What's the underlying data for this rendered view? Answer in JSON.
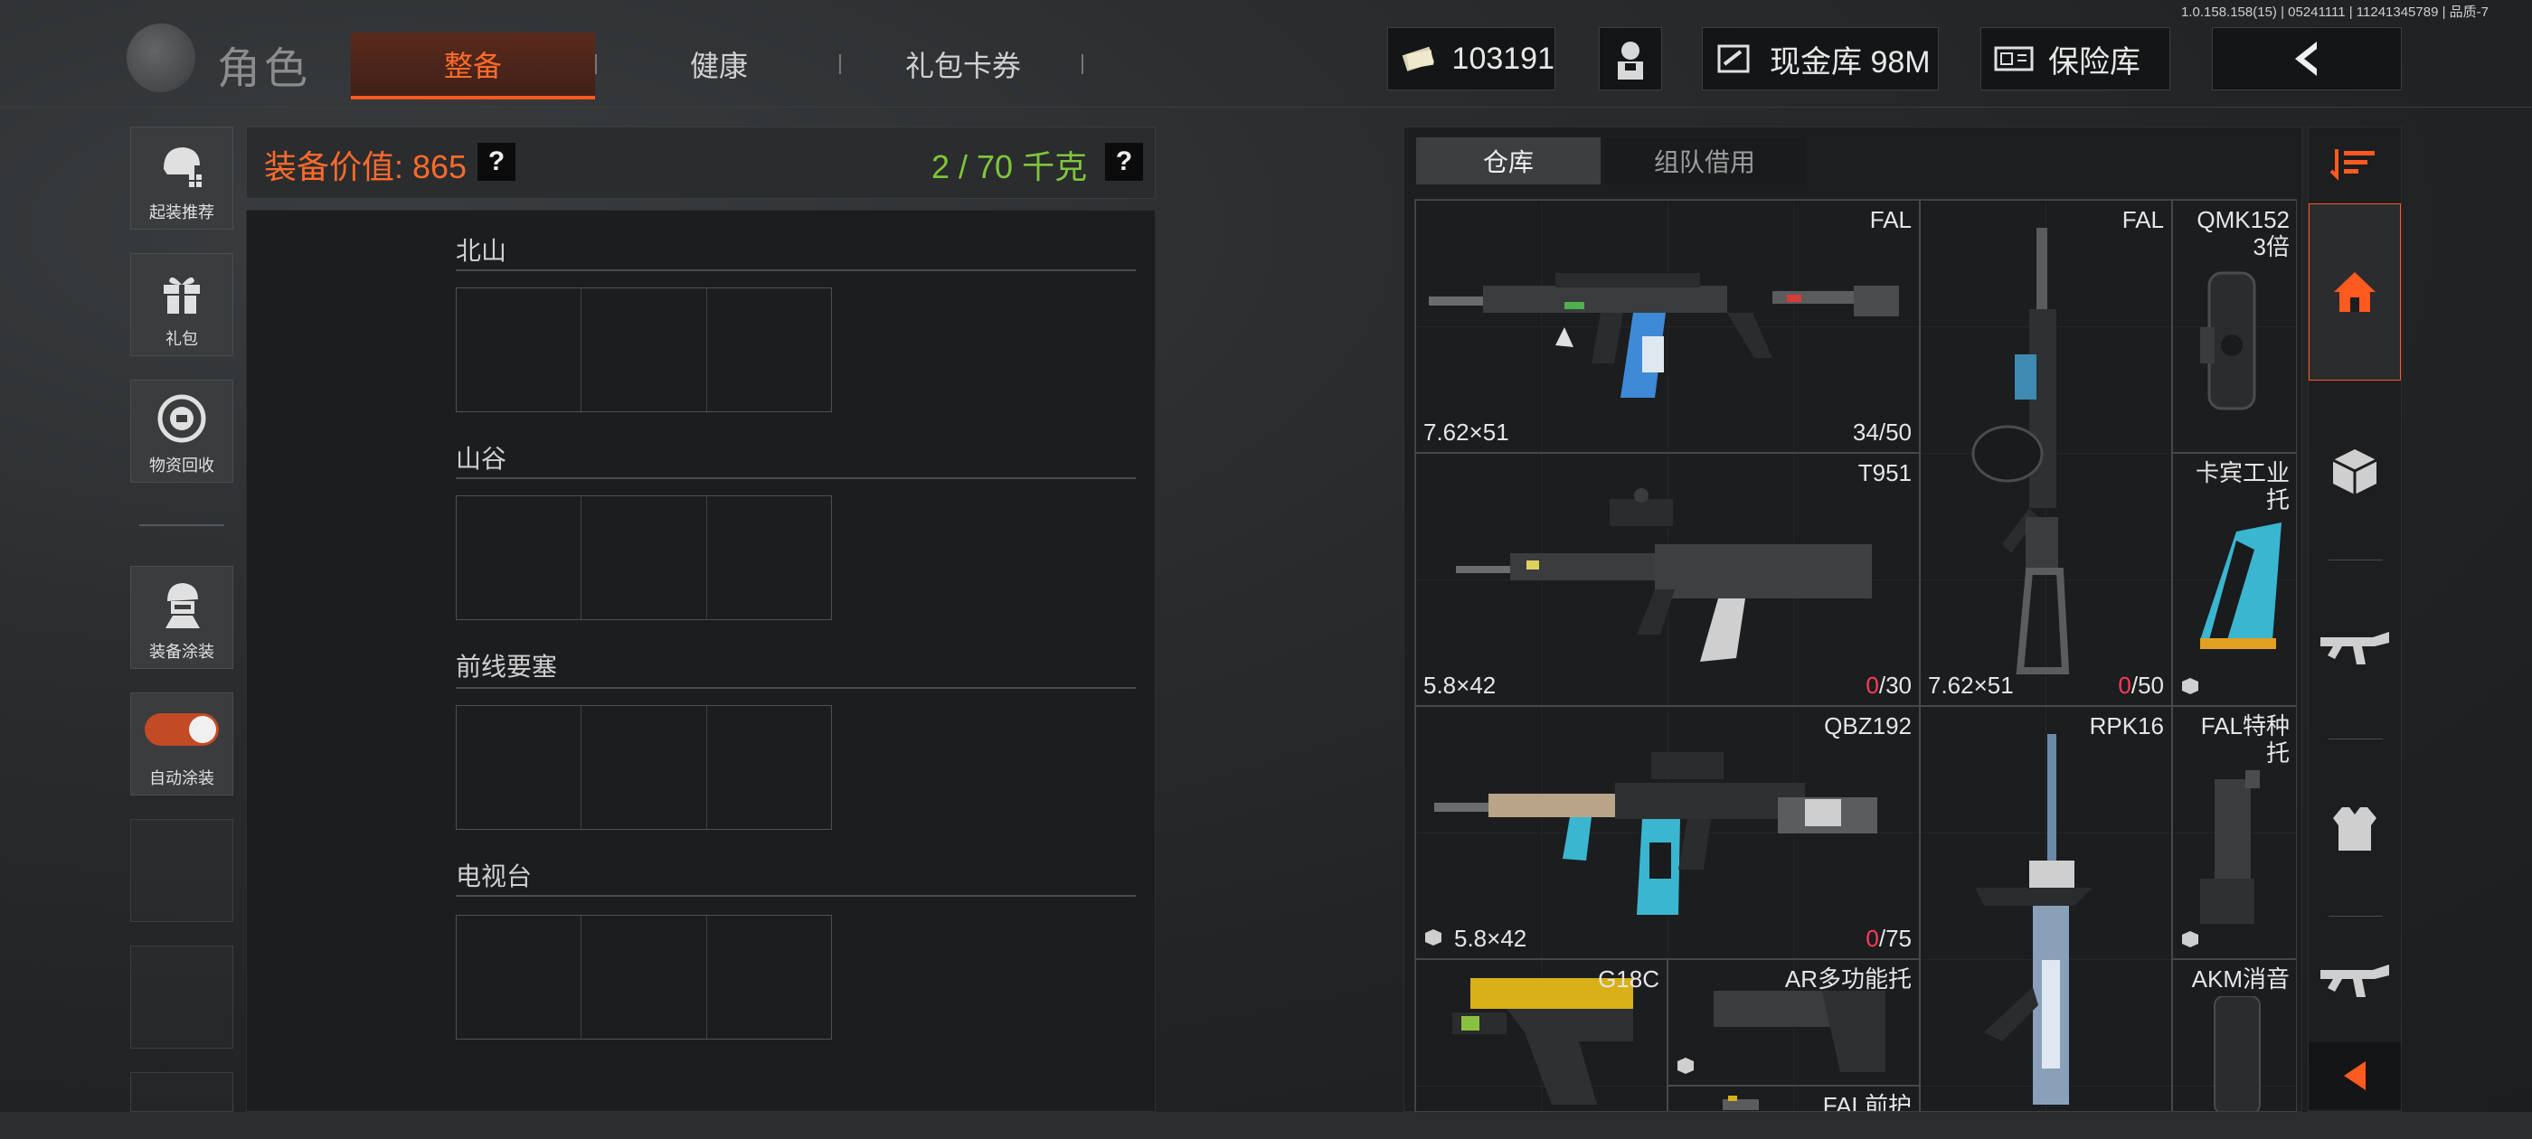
{
  "version": "1.0.158.158(15) | 05241111 | 11241345789 | 品质-7",
  "header": {
    "title": "角色",
    "tabs": [
      {
        "label": "整备",
        "active": true
      },
      {
        "label": "健康",
        "active": false
      },
      {
        "label": "礼包卡券",
        "active": false
      }
    ],
    "currency": "103191",
    "cash_vault": "现金库 98M",
    "safe_vault": "保险库"
  },
  "sidebar": {
    "items": [
      {
        "label": "起装推荐",
        "icon": "helmet-grid-icon"
      },
      {
        "label": "礼包",
        "icon": "gift-icon"
      },
      {
        "label": "物资回收",
        "icon": "recycle-icon"
      },
      {
        "label": "装备涂装",
        "icon": "soldier-paint-icon"
      },
      {
        "label": "自动涂装",
        "icon": "toggle-switch",
        "toggle_on": true
      }
    ]
  },
  "loadout": {
    "value_label": "装备价值: 865",
    "weight_label": "2 / 70 千克",
    "help": "?",
    "sections": [
      "北山",
      "山谷",
      "前线要塞",
      "电视台"
    ]
  },
  "inventory": {
    "tabs": [
      "仓库",
      "组队借用"
    ],
    "items": [
      {
        "name": "FAL",
        "caliber": "7.62×51",
        "ammo_current": "34",
        "ammo_max": "/50",
        "empty": false,
        "kind": "rifle"
      },
      {
        "name": "FAL",
        "caliber": "7.62×51",
        "ammo_current": "0",
        "ammo_max": "/50",
        "empty": true,
        "kind": "rifle-vertical"
      },
      {
        "name": "QMK152\n3倍",
        "kind": "scope"
      },
      {
        "name": "T951",
        "caliber": "5.8×42",
        "ammo_current": "0",
        "ammo_max": "/30",
        "empty": true,
        "kind": "rifle"
      },
      {
        "name": "卡宾工业托",
        "kind": "stock"
      },
      {
        "name": "QBZ192",
        "caliber": "5.8×42",
        "ammo_current": "0",
        "ammo_max": "/75",
        "empty": true,
        "kind": "rifle"
      },
      {
        "name": "RPK16",
        "kind": "rifle-vertical"
      },
      {
        "name": "FAL特种\n托",
        "kind": "stock"
      },
      {
        "name": "G18C",
        "kind": "pistol"
      },
      {
        "name": "AR多功能托",
        "kind": "stock"
      },
      {
        "name": "AKM消音",
        "kind": "suppressor"
      },
      {
        "name": "FAL前护",
        "kind": "handguard"
      }
    ]
  },
  "colors": {
    "accent": "#ff5a1f",
    "weight_green": "#7ec63a",
    "ammo_empty": "#ff3a5a"
  }
}
